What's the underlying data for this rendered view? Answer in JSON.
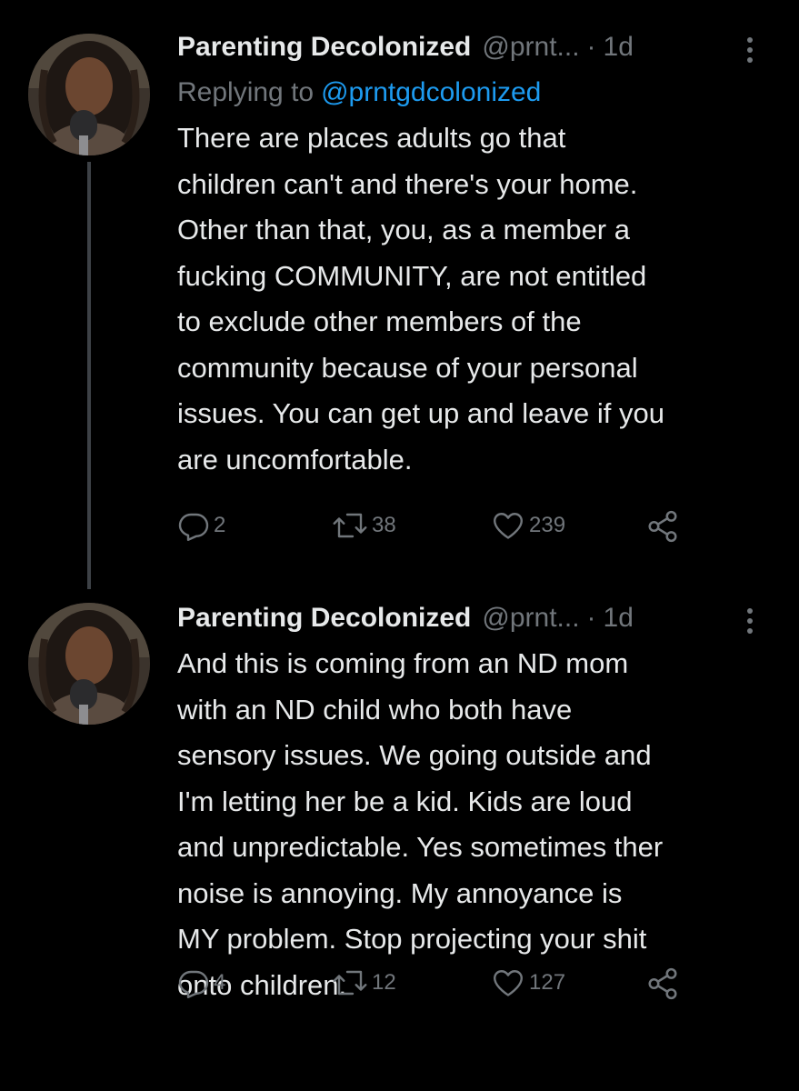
{
  "theme": {
    "background": "#000000",
    "text": "#e7e9ea",
    "muted": "#71767b",
    "link": "#1d9bf0",
    "thread_line": "#3d4146"
  },
  "tweets": [
    {
      "avatar_icon": "profile-photo",
      "display_name": "Parenting Decolonized",
      "handle": "@prnt...",
      "dot": "·",
      "time": "1d",
      "reply_to_label": "Replying to",
      "reply_to_handle": "@prntgdcolonized",
      "lines": [
        "There are places adults go that",
        "children can't and there's your home.",
        "Other than that, you, as a member a",
        "fucking COMMUNITY, are not entitled",
        "to exclude other members of the",
        "community because of your personal",
        "issues. You can get up and leave if you",
        "are uncomfortable."
      ],
      "replies": "2",
      "retweets": "38",
      "likes": "239"
    },
    {
      "avatar_icon": "profile-photo",
      "display_name": "Parenting Decolonized",
      "handle": "@prnt...",
      "dot": "·",
      "time": "1d",
      "lines": [
        "And this is coming from an ND mom",
        "with an ND child who both have",
        "sensory issues. We going outside and",
        "I'm letting her be a kid. Kids are loud",
        "and unpredictable. Yes sometimes ther",
        "noise is annoying. My annoyance is",
        "MY problem. Stop projecting your shit",
        "onto children."
      ],
      "replies": "4",
      "retweets": "12",
      "likes": "127"
    }
  ],
  "icons": {
    "reply": "reply-icon",
    "retweet": "retweet-icon",
    "like": "heart-icon",
    "share": "share-icon",
    "more": "more-icon"
  }
}
